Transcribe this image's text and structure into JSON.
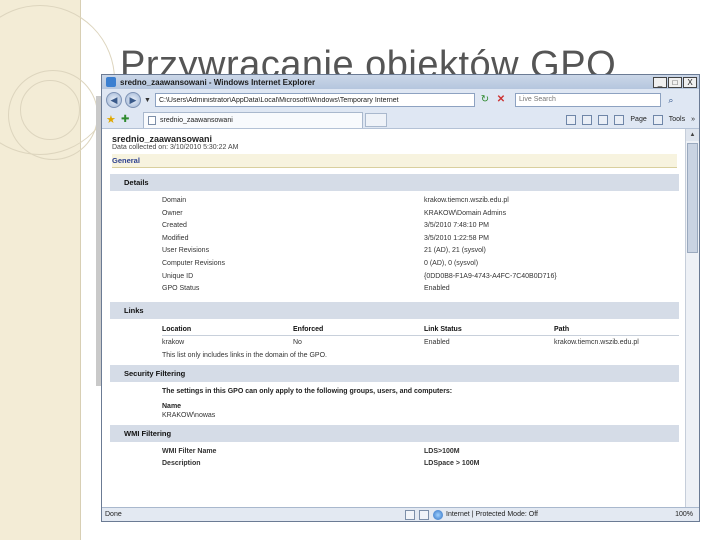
{
  "slide": {
    "title": "Przywracanie obiektów GPO"
  },
  "window": {
    "title": "sredno_zaawansowani - Windows Internet Explorer",
    "min": "_",
    "max": "□",
    "close": "X"
  },
  "address": {
    "url": "C:\\Users\\Administrator\\AppData\\Local\\Microsoft\\Windows\\Temporary Internet",
    "search_placeholder": "Live Search"
  },
  "tabbar": {
    "tab_title": "srednio_zaawansowani",
    "page_label": "Page",
    "tools_label": "Tools"
  },
  "report": {
    "gpo_name": "srednio_zaawansowani",
    "collected": "Data collected on: 3/10/2010 5:30:22 AM",
    "general": "General",
    "details": {
      "heading": "Details",
      "rows": [
        {
          "key": "Domain",
          "value": "krakow.tiemcn.wszib.edu.pl"
        },
        {
          "key": "Owner",
          "value": "KRAKOW\\Domain Admins"
        },
        {
          "key": "Created",
          "value": "3/5/2010 7:48:10 PM"
        },
        {
          "key": "Modified",
          "value": "3/5/2010 1:22:58 PM"
        },
        {
          "key": "User Revisions",
          "value": "21 (AD), 21 (sysvol)"
        },
        {
          "key": "Computer Revisions",
          "value": "0 (AD), 0 (sysvol)"
        },
        {
          "key": "Unique ID",
          "value": "{0DD0B8-F1A9-4743-A4FC-7C40B0D716}"
        },
        {
          "key": "GPO Status",
          "value": "Enabled"
        }
      ]
    },
    "links": {
      "heading": "Links",
      "columns": [
        "Location",
        "Enforced",
        "Link Status",
        "Path"
      ],
      "rows": [
        [
          "krakow",
          "No",
          "Enabled",
          "krakow.tiemcn.wszib.edu.pl"
        ]
      ],
      "note": "This list only includes links in the domain of the GPO."
    },
    "security": {
      "heading": "Security Filtering",
      "desc": "The settings in this GPO can only apply to the following groups, users, and computers:",
      "name_header": "Name",
      "name_value": "KRAKOW\\nowas"
    },
    "wmi": {
      "heading": "WMI Filtering",
      "rows": [
        {
          "key": "WMI Filter Name",
          "value": "LDS>100M"
        },
        {
          "key": "Description",
          "value": "LDSpace > 100M"
        }
      ]
    }
  },
  "status": {
    "done": "Done",
    "zone": "Internet | Protected Mode: Off",
    "zoom": "100%"
  }
}
